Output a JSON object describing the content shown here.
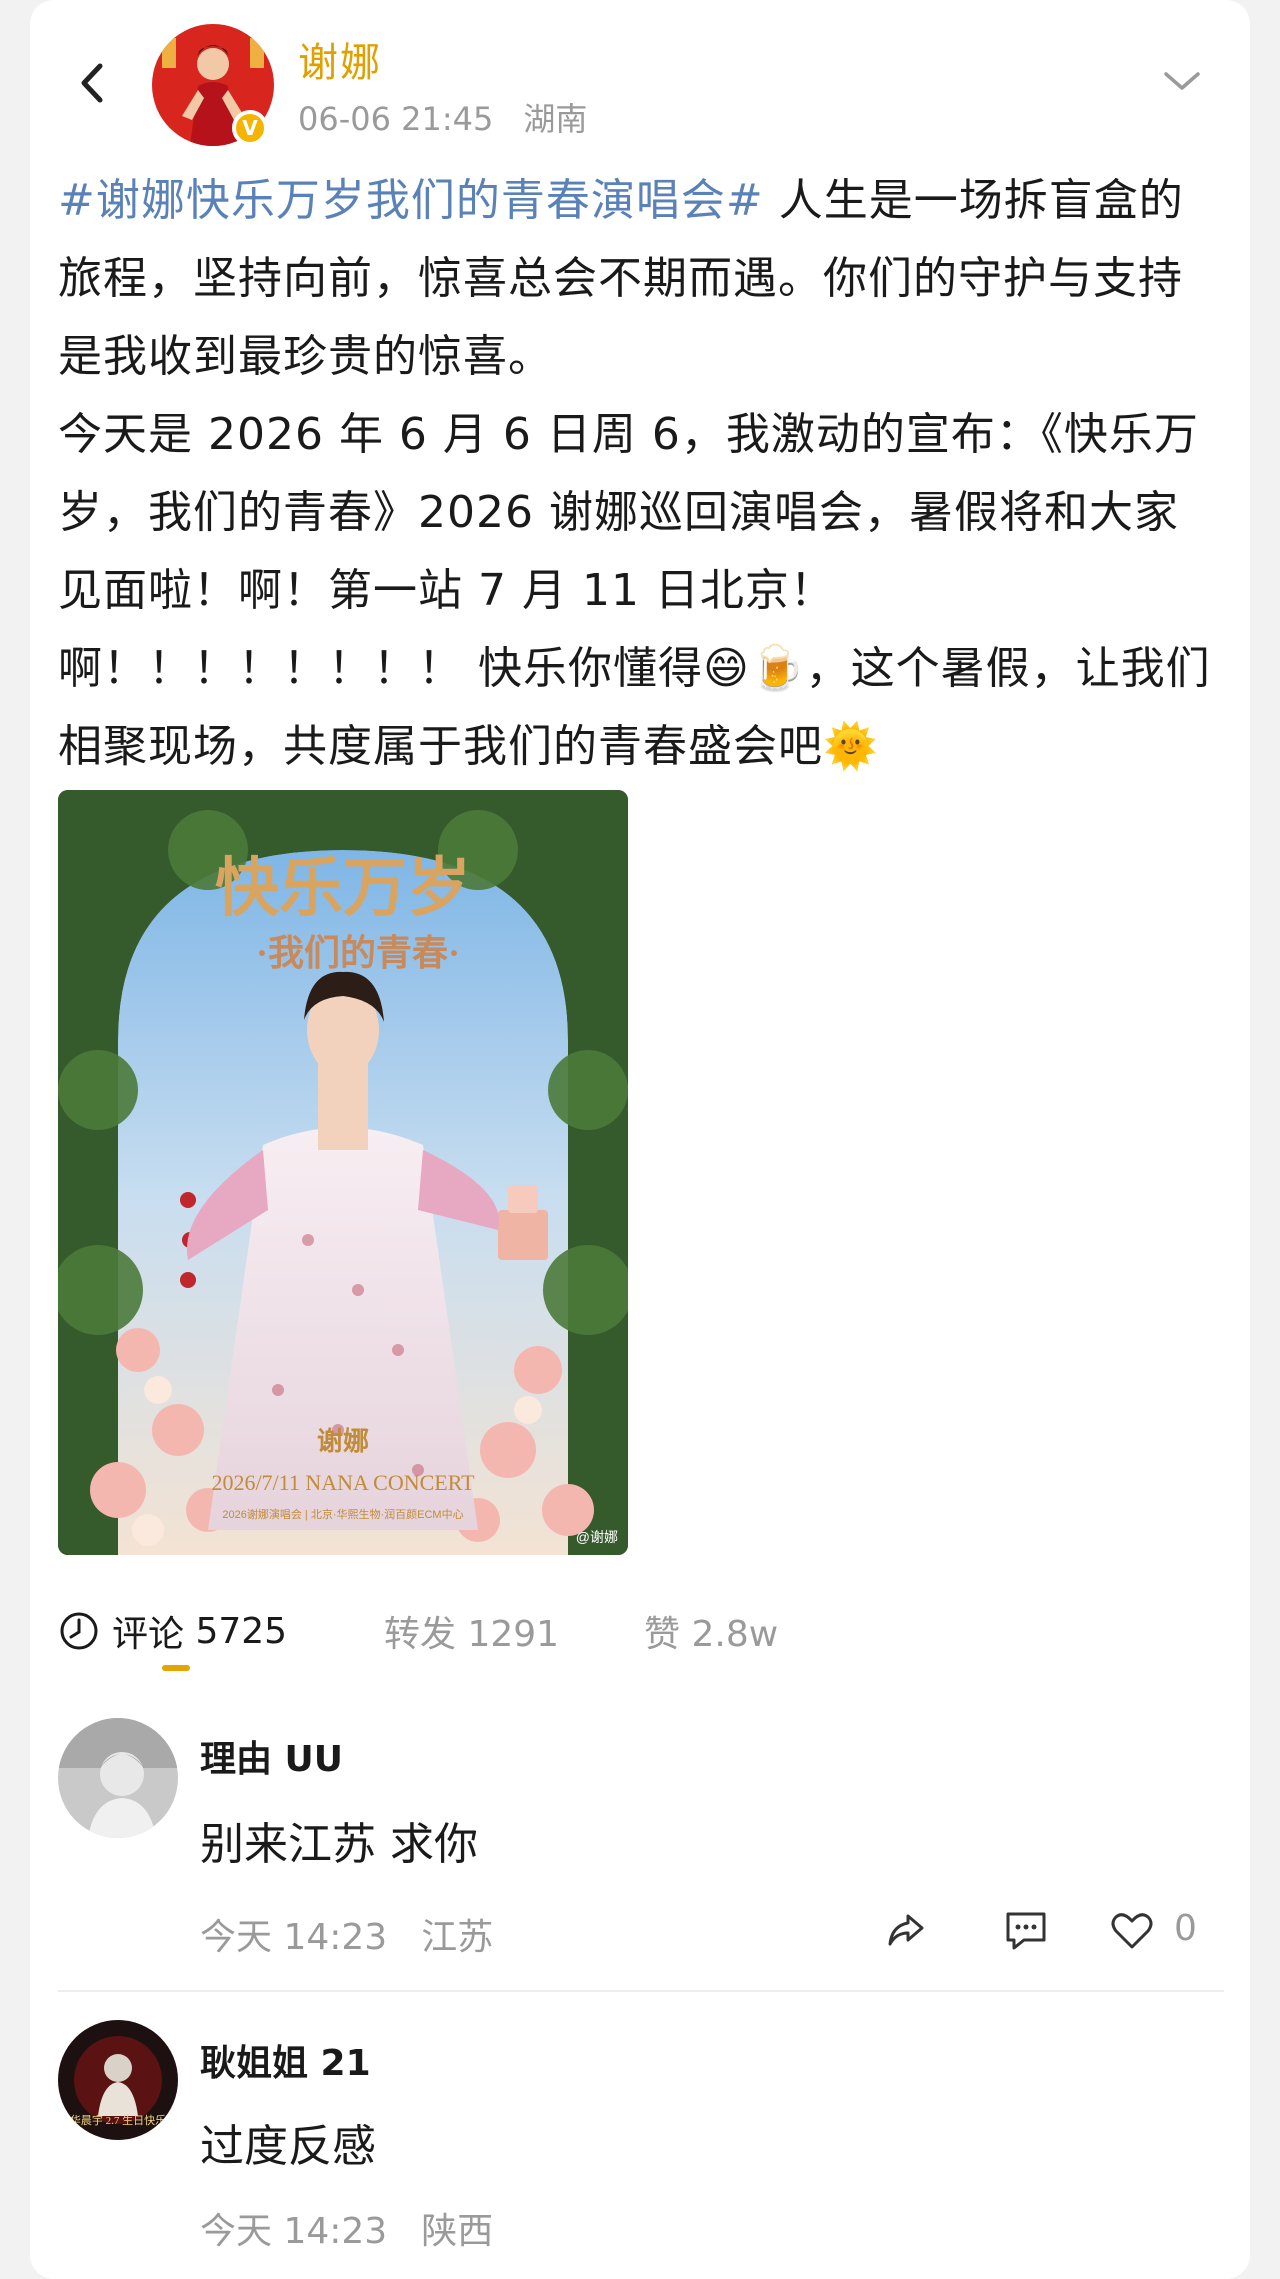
{
  "header": {
    "author_name": "谢娜",
    "date": "06-06 21:45",
    "location": "湖南",
    "verified_badge": "V",
    "icons": {
      "back": "chevron-left-icon",
      "more": "chevron-down-icon"
    }
  },
  "post": {
    "hashtag": "#谢娜快乐万岁我们的青春演唱会#",
    "text_1": " 人生是一场拆盲盒的旅程，坚持向前，惊喜总会不期而遇。你们的守护与支持是我收到最珍贵的惊喜。",
    "text_2": "今天是 2026 年 6 月 6 日周 6，我激动的宣布：《快乐万岁，我们的青春》2026 谢娜巡回演唱会，暑假将和大家见面啦！啊！第一站 7 月 11 日北京！啊！！！！！！！！ 快乐你懂得",
    "emoji_1": "😄",
    "emoji_2": "🍺",
    "text_3": "，这个暑假，让我们相聚现场，共度属于我们的青春盛会吧",
    "emoji_3": "🌞",
    "colors": {
      "hashtag": "#5a82b8",
      "author": "#e2a000",
      "accent": "#e6a400"
    }
  },
  "poster": {
    "title_main": "快乐万岁",
    "title_sub": "·我们的青春·",
    "name": "谢娜",
    "concert_line": "2026/7/11  NANA CONCERT",
    "small_line": "2026谢娜演唱会 | 北京·华熙生物·润百颜ECM中心",
    "watermark": "@谢娜"
  },
  "tabs": {
    "comments_label": "评论",
    "comments_count": "5725",
    "reposts_label": "转发",
    "reposts_count": "1291",
    "likes_label": "赞",
    "likes_count": "2.8w"
  },
  "comments": [
    {
      "name": "理由 UU",
      "text": "别来江苏 求你",
      "time": "今天 14:23",
      "location": "江苏",
      "like_count": "0"
    },
    {
      "name": "耿姐姐 21",
      "text": "过度反感",
      "time": "今天 14:23",
      "location": "陕西",
      "avatar_text": "华晨宇 2.7 生日快乐"
    }
  ]
}
